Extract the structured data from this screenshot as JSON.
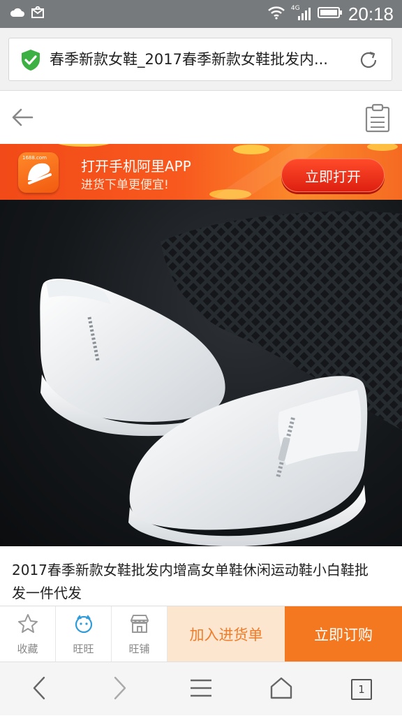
{
  "status_bar": {
    "time": "20:18",
    "network": "4G",
    "icons": [
      "cloud-icon",
      "mail-icon",
      "wifi-icon",
      "signal-icon",
      "battery-icon"
    ]
  },
  "address_bar": {
    "page_title": "春季新款女鞋_2017春季新款女鞋批发内...",
    "secure_icon": "shield-check-icon",
    "refresh_icon": "refresh-icon"
  },
  "nav": {
    "back_icon": "back-arrow-icon",
    "clipboard_icon": "clipboard-icon"
  },
  "app_banner": {
    "line1": "打开手机阿里APP",
    "line2": "进货下单更便宜!",
    "button": "立即打开",
    "logo_caption": "1688.com"
  },
  "product": {
    "title": "2017春季新款女鞋批发内增高女单鞋休闲运动鞋小白鞋批发一件代发"
  },
  "bottom_bar": {
    "favorite": "收藏",
    "wangwang": "旺旺",
    "shop": "旺铺",
    "add_to_list": "加入进货单",
    "buy_now": "立即订购"
  },
  "browser_bar": {
    "tab_count": "1"
  },
  "colors": {
    "status_bar": "#777a7c",
    "banner_orange": "#f8591e",
    "buy_orange": "#f47820",
    "add_bg": "#fde6cf",
    "add_text": "#f07c2a",
    "secure_green": "#3cb043"
  }
}
